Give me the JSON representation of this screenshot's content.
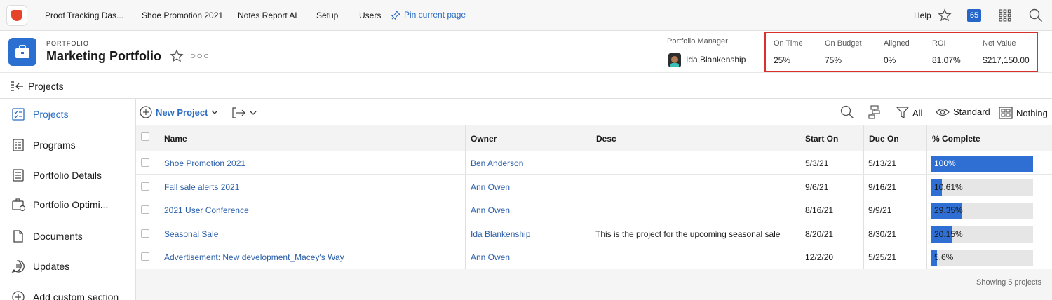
{
  "topnav": {
    "items": [
      "Proof Tracking Das...",
      "Shoe Promotion 2021",
      "Notes Report AL",
      "Setup",
      "Users"
    ],
    "pin_label": "Pin current page",
    "help_label": "Help",
    "badge_count": "65"
  },
  "portfolio": {
    "kicker": "PORTFOLIO",
    "title": "Marketing Portfolio",
    "manager_label": "Portfolio Manager",
    "manager_name": "Ida Blankenship"
  },
  "metrics": [
    {
      "label": "On Time",
      "value": "25%"
    },
    {
      "label": "On Budget",
      "value": "75%"
    },
    {
      "label": "Aligned",
      "value": "0%"
    },
    {
      "label": "ROI",
      "value": "81.07%"
    },
    {
      "label": "Net Value",
      "value": "$217,150.00"
    }
  ],
  "section": {
    "title": "Projects"
  },
  "sidebar": {
    "items": [
      {
        "label": "Projects",
        "icon": "projects-icon"
      },
      {
        "label": "Programs",
        "icon": "programs-icon"
      },
      {
        "label": "Portfolio Details",
        "icon": "details-icon"
      },
      {
        "label": "Portfolio Optimi...",
        "icon": "optimizer-icon"
      },
      {
        "label": "Documents",
        "icon": "document-icon"
      },
      {
        "label": "Updates",
        "icon": "updates-icon"
      },
      {
        "label": "Add custom section",
        "icon": "add-icon"
      }
    ]
  },
  "toolbar": {
    "new_project": "New Project",
    "filter_label": "All",
    "view_label": "Standard",
    "group_label": "Nothing"
  },
  "table": {
    "columns": [
      "Name",
      "Owner",
      "Desc",
      "Start On",
      "Due On",
      "% Complete"
    ],
    "rows": [
      {
        "name": "Shoe Promotion 2021",
        "owner": "Ben Anderson",
        "desc": "",
        "start": "5/3/21",
        "due": "5/13/21",
        "complete_label": "100%",
        "complete": 100
      },
      {
        "name": "Fall sale alerts 2021",
        "owner": "Ann Owen",
        "desc": "",
        "start": "9/6/21",
        "due": "9/16/21",
        "complete_label": "10.61%",
        "complete": 10.61
      },
      {
        "name": "2021 User Conference",
        "owner": "Ann Owen",
        "desc": "",
        "start": "8/16/21",
        "due": "9/9/21",
        "complete_label": "29.35%",
        "complete": 29.35
      },
      {
        "name": "Seasonal Sale",
        "owner": "Ida Blankenship",
        "desc": "This is the project for the upcoming seasonal sale",
        "start": "8/20/21",
        "due": "8/30/21",
        "complete_label": "20.15%",
        "complete": 20.15
      },
      {
        "name": "Advertisement: New development_Macey's Way",
        "owner": "Ann Owen",
        "desc": "",
        "start": "12/2/20",
        "due": "5/25/21",
        "complete_label": "5.6%",
        "complete": 5.6
      }
    ],
    "footer": "Showing 5 projects"
  }
}
